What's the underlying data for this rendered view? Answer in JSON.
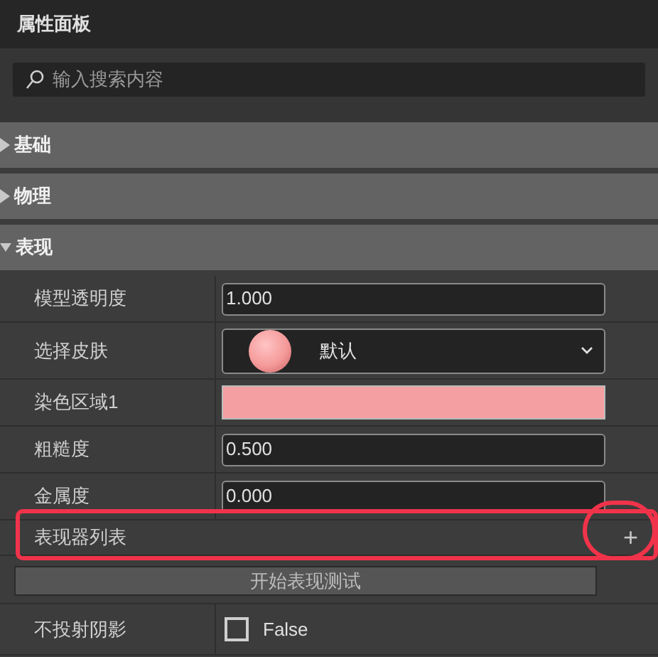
{
  "panel": {
    "title": "属性面板"
  },
  "search": {
    "placeholder": "输入搜索内容"
  },
  "sections": [
    {
      "label": "基础",
      "expanded": false
    },
    {
      "label": "物理",
      "expanded": false
    },
    {
      "label": "表现",
      "expanded": true,
      "rows": [
        {
          "kind": "number",
          "label": "模型透明度",
          "value": "1.000"
        },
        {
          "kind": "skin",
          "label": "选择皮肤",
          "value": "默认",
          "color": "#f59a9a"
        },
        {
          "kind": "color",
          "label": "染色区域1",
          "color": "#f4a0a3"
        },
        {
          "kind": "number",
          "label": "粗糙度",
          "value": "0.500"
        },
        {
          "kind": "number",
          "label": "金属度",
          "value": "0.000"
        },
        {
          "kind": "list",
          "label": "表现器列表",
          "add": "+"
        },
        {
          "kind": "button",
          "label": "开始表现测试"
        },
        {
          "kind": "checkbox",
          "label": "不投射阴影",
          "checked": false,
          "value": "False"
        }
      ]
    }
  ],
  "annotation": {
    "highlighted": true
  }
}
